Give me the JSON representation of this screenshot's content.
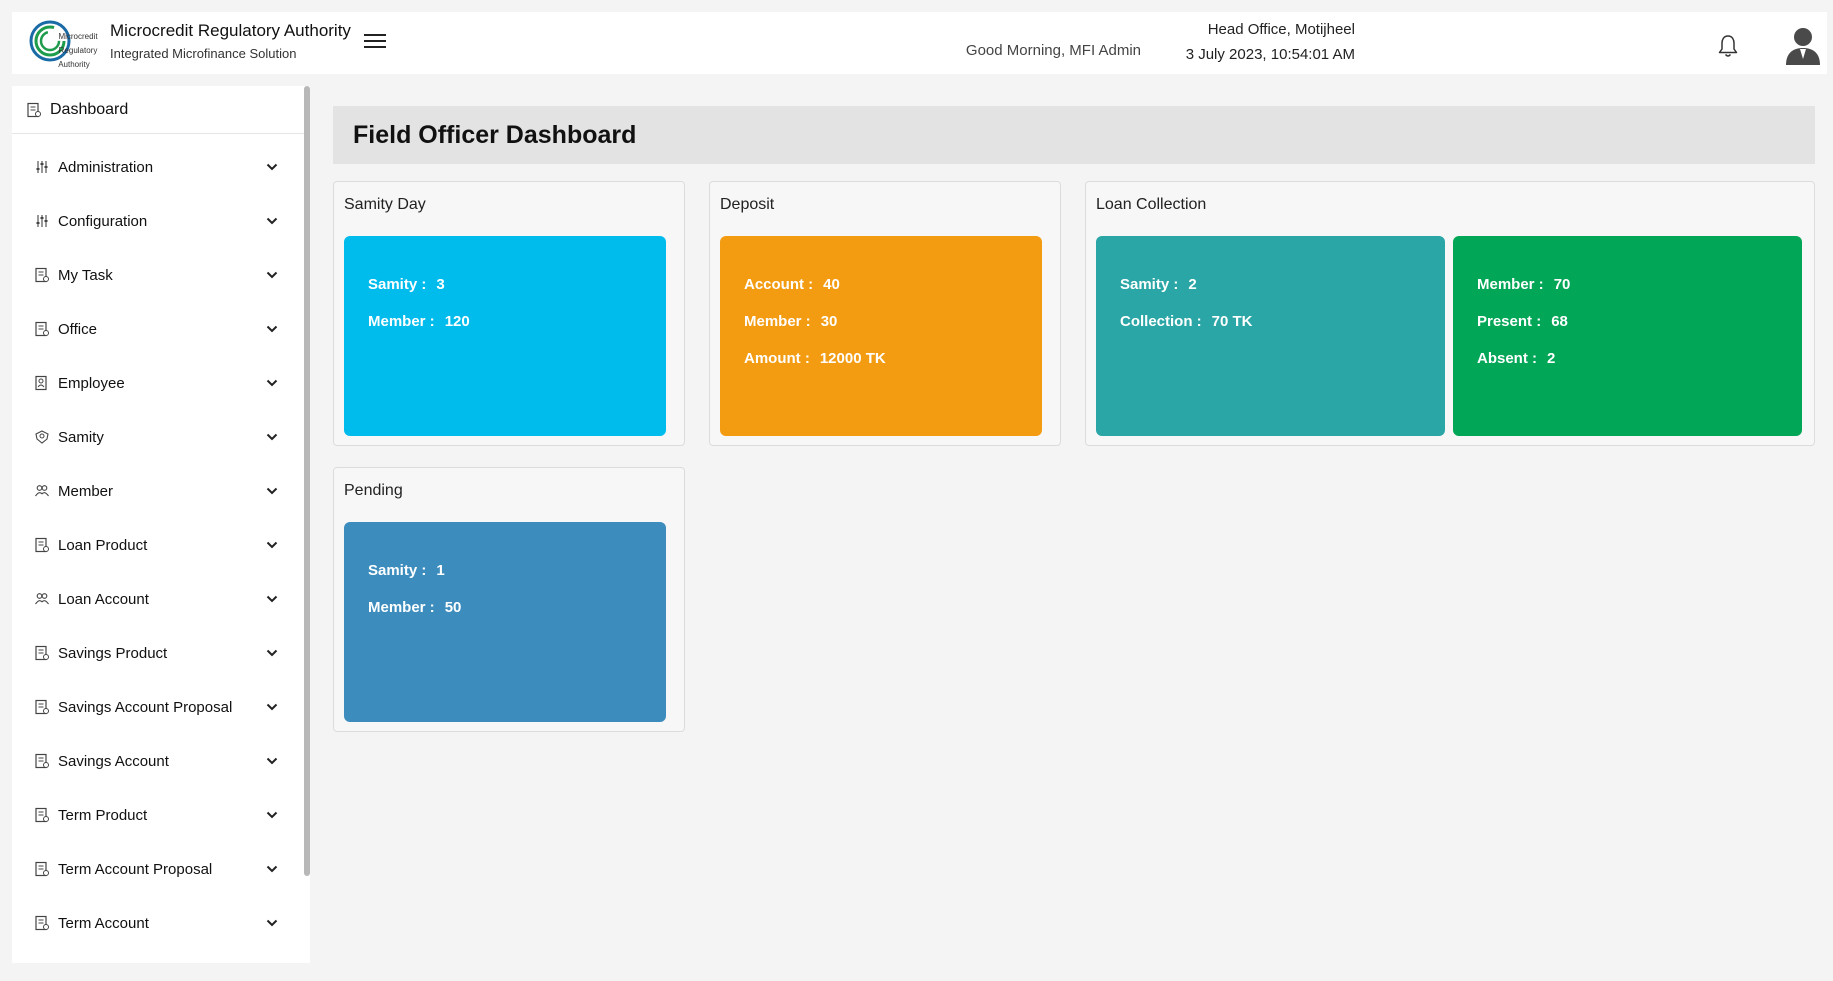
{
  "header": {
    "logo_text": [
      "Microcredit",
      "Regulatory",
      "Authority"
    ],
    "org_name": "Microcredit Regulatory Authority",
    "org_subtitle": "Integrated Microfinance Solution",
    "greeting": "Good Morning, MFI Admin",
    "office": "Head Office, Motijheel",
    "datetime": "3 July 2023, 10:54:01 AM"
  },
  "sidebar": {
    "dashboard_label": "Dashboard",
    "items": [
      {
        "label": "Administration",
        "icon": "sliders-icon"
      },
      {
        "label": "Configuration",
        "icon": "sliders-icon"
      },
      {
        "label": "My Task",
        "icon": "document-icon"
      },
      {
        "label": "Office",
        "icon": "document-icon"
      },
      {
        "label": "Employee",
        "icon": "document-user-icon"
      },
      {
        "label": "Samity",
        "icon": "group-icon"
      },
      {
        "label": "Member",
        "icon": "users-icon"
      },
      {
        "label": "Loan Product",
        "icon": "document-icon"
      },
      {
        "label": "Loan Account",
        "icon": "users-icon"
      },
      {
        "label": "Savings Product",
        "icon": "document-icon"
      },
      {
        "label": "Savings Account Proposal",
        "icon": "document-icon"
      },
      {
        "label": "Savings Account",
        "icon": "document-icon"
      },
      {
        "label": "Term Product",
        "icon": "document-icon"
      },
      {
        "label": "Term Account Proposal",
        "icon": "document-icon"
      },
      {
        "label": "Term Account",
        "icon": "document-icon"
      }
    ]
  },
  "main": {
    "title": "Field Officer Dashboard",
    "panels": {
      "samity_day": {
        "title": "Samity Day",
        "color": "#00bced",
        "rows": [
          {
            "label": "Samity :",
            "value": "3"
          },
          {
            "label": "Member :",
            "value": "120"
          }
        ]
      },
      "deposit": {
        "title": "Deposit",
        "color": "#f39c12",
        "rows": [
          {
            "label": "Account :",
            "value": "40"
          },
          {
            "label": "Member :",
            "value": "30"
          },
          {
            "label": "Amount :",
            "value": "12000 TK"
          }
        ]
      },
      "loan_collection": {
        "title": "Loan Collection",
        "cards": [
          {
            "color": "#2ba6a6",
            "rows": [
              {
                "label": "Samity :",
                "value": "2"
              },
              {
                "label": "Collection :",
                "value": "70 TK"
              }
            ]
          },
          {
            "color": "#02a657",
            "rows": [
              {
                "label": "Member :",
                "value": "70"
              },
              {
                "label": "Present :",
                "value": "68"
              },
              {
                "label": "Absent :",
                "value": "2"
              }
            ]
          }
        ]
      },
      "pending": {
        "title": "Pending",
        "color": "#3c8dbd",
        "rows": [
          {
            "label": "Samity :",
            "value": "1"
          },
          {
            "label": "Member :",
            "value": "50"
          }
        ]
      }
    }
  }
}
